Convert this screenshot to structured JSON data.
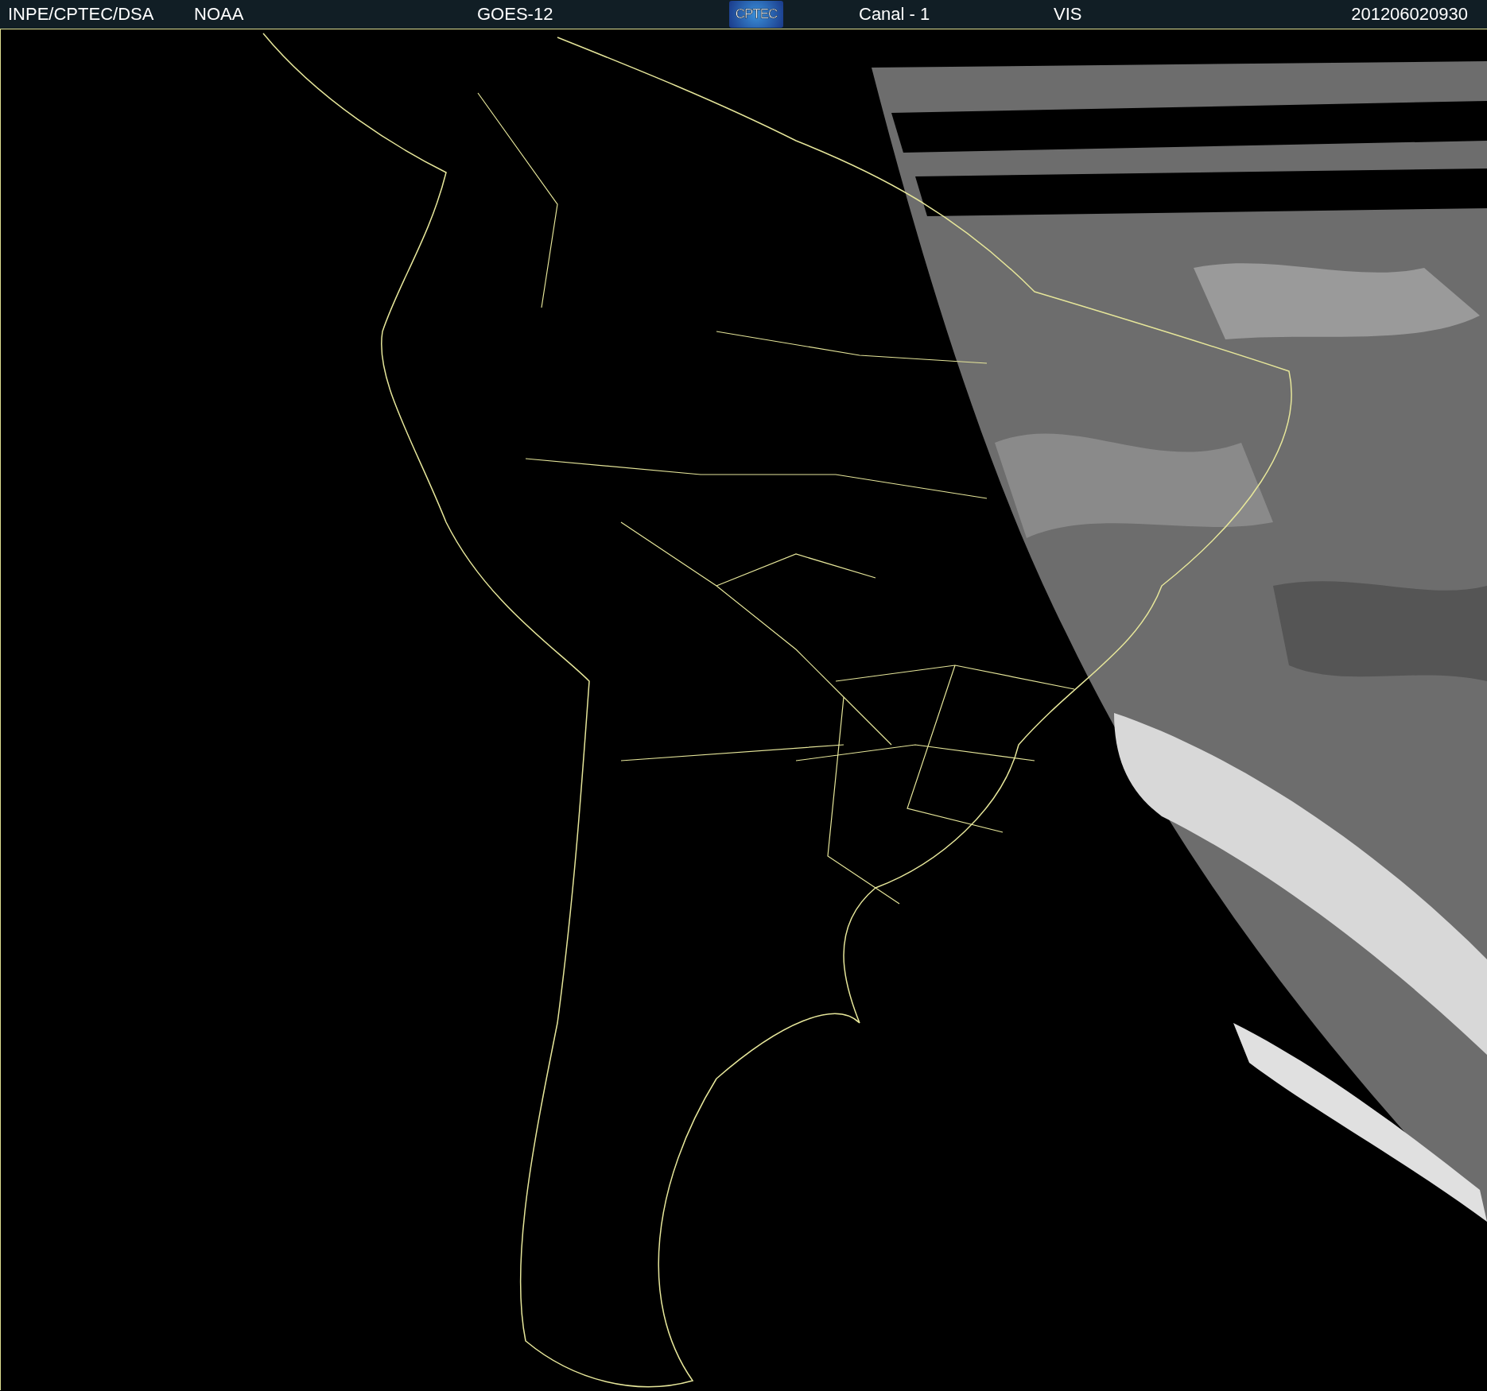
{
  "header": {
    "source": "INPE/CPTEC/DSA",
    "agency": "NOAA",
    "satellite": "GOES-12",
    "logo": "CPTEC",
    "channel": "Canal - 1",
    "band": "VIS",
    "timestamp": "201206020930"
  }
}
